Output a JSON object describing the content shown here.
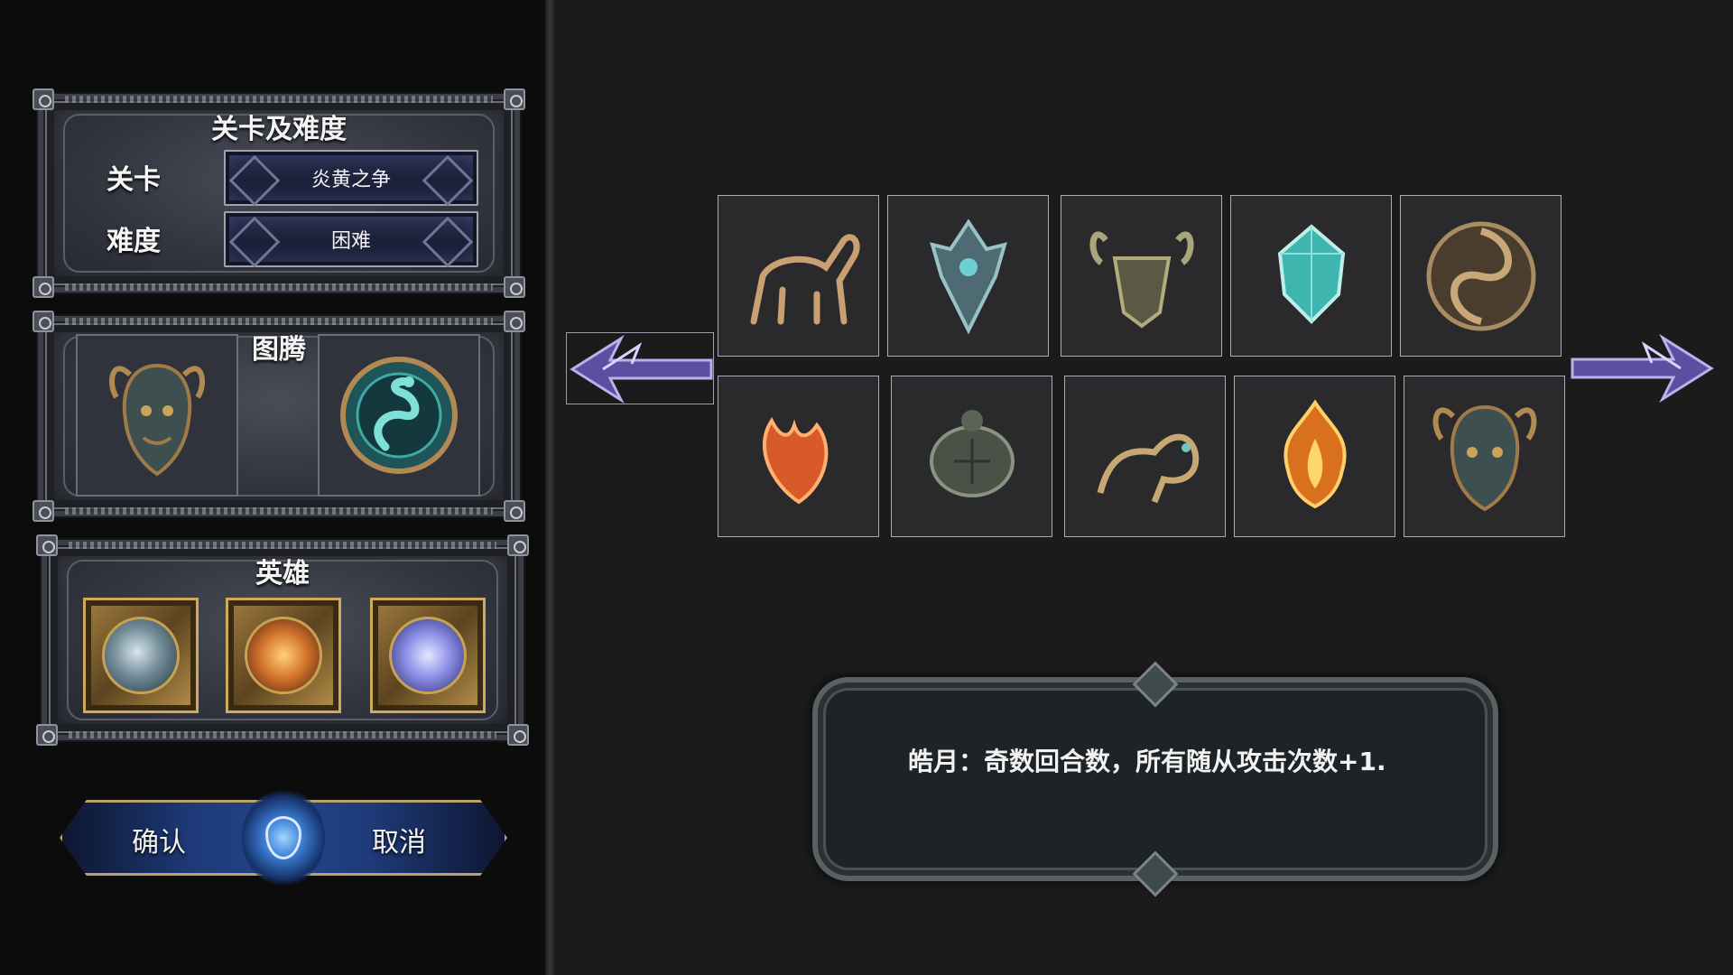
{
  "level_panel": {
    "title": "关卡及难度",
    "level_label": "关卡",
    "level_value": "炎黄之争",
    "difficulty_label": "难度",
    "difficulty_value": "困难"
  },
  "totem_panel": {
    "title": "图腾",
    "slots": [
      {
        "icon": "horned-demon-emblem-icon"
      },
      {
        "icon": "teal-dragon-emblem-icon"
      }
    ]
  },
  "hero_panel": {
    "title": "英雄",
    "heroes": [
      {
        "icon": "storm-hero-portrait-icon",
        "color": "#6f8a96"
      },
      {
        "icon": "fire-hero-portrait-icon",
        "color": "#d4742c"
      },
      {
        "icon": "moon-hero-portrait-icon",
        "color": "#8a8ee6"
      }
    ]
  },
  "actions": {
    "confirm_label": "确认",
    "cancel_label": "取消"
  },
  "totem_grid": [
    {
      "icon": "bronze-goat-icon",
      "color": "#8a6a4a"
    },
    {
      "icon": "masked-serpent-icon",
      "color": "#5e7e86"
    },
    {
      "icon": "horned-beast-face-icon",
      "color": "#7a7a5e"
    },
    {
      "icon": "teal-crystal-icon",
      "color": "#3fb5b0"
    },
    {
      "icon": "spiral-swirl-icon",
      "color": "#7d6a52"
    },
    {
      "icon": "phoenix-icon",
      "color": "#d85a2a"
    },
    {
      "icon": "turtle-icon",
      "color": "#5b6256"
    },
    {
      "icon": "qilin-icon",
      "color": "#a38a52"
    },
    {
      "icon": "flame-emblem-icon",
      "color": "#d8701e"
    },
    {
      "icon": "horned-demon-emblem-icon",
      "color": "#4e6a6a"
    }
  ],
  "description": {
    "text": "皓月：奇数回合数，所有随从攻击次数+1."
  },
  "colors": {
    "accent_blue": "#23458a",
    "gold_frame": "#b9a26b",
    "arrow_purple": "#6a5fb0"
  }
}
